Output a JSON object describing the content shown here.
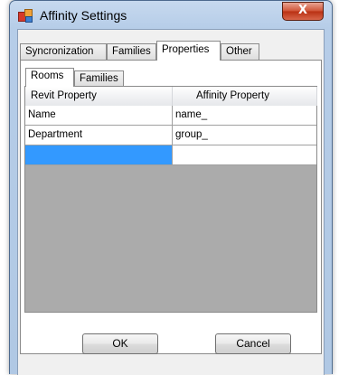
{
  "window": {
    "title": "Affinity Settings",
    "close_label": "X"
  },
  "outer_tabs": [
    {
      "label": "Syncronization"
    },
    {
      "label": "Families"
    },
    {
      "label": "Properties",
      "active": true
    },
    {
      "label": "Other"
    }
  ],
  "inner_tabs": [
    {
      "label": "Rooms",
      "active": true
    },
    {
      "label": "Families"
    }
  ],
  "grid": {
    "columns": [
      "Revit Property",
      "Affinity Property"
    ],
    "rows": [
      {
        "revit": "Name",
        "affinity": "name_"
      },
      {
        "revit": "Department",
        "affinity": "group_"
      },
      {
        "revit": "",
        "affinity": "",
        "selected": true
      }
    ]
  },
  "buttons": {
    "ok": "OK",
    "cancel": "Cancel"
  },
  "colors": {
    "selection": "#3399ff",
    "grid_background": "#ababab"
  }
}
